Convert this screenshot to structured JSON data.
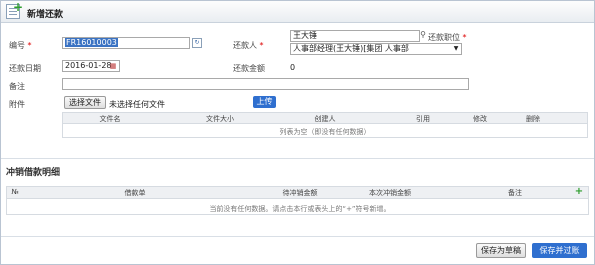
{
  "header": {
    "title": "新增还款"
  },
  "form": {
    "number_label": "编号",
    "number_value": "FR16010003",
    "repayer_label": "还款人",
    "repayer_value": "王大锤",
    "position_label": "还款职位",
    "position_value": "人事部经理(王大锤)[集团 人事部",
    "date_label": "还款日期",
    "date_value": "2016-01-28",
    "amount_label": "还款金额",
    "amount_value": "0",
    "remark_label": "备注",
    "attach_label": "附件",
    "choose_file": "选择文件",
    "no_file": "未选择任何文件",
    "upload": "上传"
  },
  "attachments": {
    "columns": [
      "文件名",
      "文件大小",
      "创建人",
      "引用",
      "修改",
      "删除"
    ],
    "empty_text": "列表为空（即没有任何数据）"
  },
  "writeoff": {
    "title": "冲销借款明细",
    "columns": [
      "№",
      "借款单",
      "待冲销金额",
      "本次冲销金额",
      "备注"
    ],
    "add_icon": "plus-icon",
    "empty_text": "当前没有任何数据。请点击本行或表头上的“+”符号新增。"
  },
  "footer": {
    "save_draft": "保存为草稿",
    "save_submit": "保存并过账"
  },
  "colors": {
    "accent": "#2f6fcf",
    "required": "#dd0000",
    "add_icon": "#2e9d2e"
  }
}
